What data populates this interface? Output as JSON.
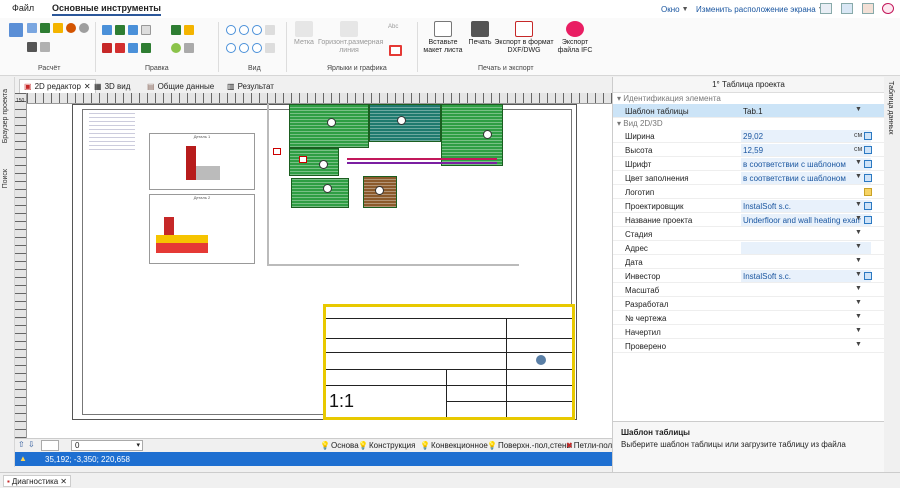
{
  "menu": {
    "file": "Файл",
    "main_tools": "Основные инструменты"
  },
  "topright": {
    "window": "Окно",
    "layout": "Изменить расположение экрана"
  },
  "ribbon": {
    "groups": {
      "calc": "Расчёт",
      "edit": "Правка",
      "view": "Вид",
      "labels": "Ярлыки и графика",
      "print_export": "Печать и экспорт"
    },
    "label_btn": "Метка",
    "horiz_dim": "Горизонт.размерная линия",
    "abc": "Abc",
    "insert_sheet": "Вставьте макет листа",
    "print": "Печать",
    "export_dxf": "Экспорт в формат DXF/DWG",
    "export_ifc": "Экспорт файла IFC"
  },
  "tabs": [
    {
      "label": "2D редактор"
    },
    {
      "label": "3D вид"
    },
    {
      "label": "Общие данные"
    },
    {
      "label": "Результат"
    }
  ],
  "left_strip": {
    "browser": "Браузер проекта",
    "search": "Поиск"
  },
  "right_strip": {
    "table_data": "Таблица данных"
  },
  "ruler": {
    "v_start": "150"
  },
  "canvas": {
    "scale": "1:1",
    "detail1_title": "Деталь 1",
    "detail2_title": "Деталь 2"
  },
  "layers": {
    "level": "0",
    "items": [
      "Основа",
      "Конструкция",
      "Конвекционное",
      "Поверхн.-пол,стены",
      "Петли-пол"
    ]
  },
  "status": {
    "coords": "35,192; -3,350; 220,658"
  },
  "diagnostics": "Диагностика",
  "props": {
    "title": "1° Таблица проекта",
    "section_id": "Идентификация элемента",
    "section_view": "Вид 2D/3D",
    "template_key": "Шаблон таблицы",
    "template_val": "Tab.1",
    "rows": [
      {
        "k": "Ширина",
        "v": "29,02",
        "u": "см"
      },
      {
        "k": "Высота",
        "v": "12,59",
        "u": "см"
      },
      {
        "k": "Шрифт",
        "v": "в соответствии с шаблоном"
      },
      {
        "k": "Цвет заполнения",
        "v": "в соответствии с шаблоном"
      },
      {
        "k": "Логотип",
        "v": ""
      },
      {
        "k": "Проектировщик",
        "v": "InstalSoft s.c."
      },
      {
        "k": "Название проекта",
        "v": "Underfloor and wall heating examp"
      },
      {
        "k": "Стадия",
        "v": ""
      },
      {
        "k": "Адрес",
        "v": ""
      },
      {
        "k": "Дата",
        "v": ""
      },
      {
        "k": "Инвестор",
        "v": "InstalSoft s.c."
      },
      {
        "k": "Масштаб",
        "v": ""
      },
      {
        "k": "Разработал",
        "v": ""
      },
      {
        "k": "№ чертежа",
        "v": ""
      },
      {
        "k": "Начертил",
        "v": ""
      },
      {
        "k": "Проверено",
        "v": ""
      }
    ],
    "desc_title": "Шаблон таблицы",
    "desc_text": "Выберите шаблон таблицы или загрузите таблицу из файла"
  }
}
